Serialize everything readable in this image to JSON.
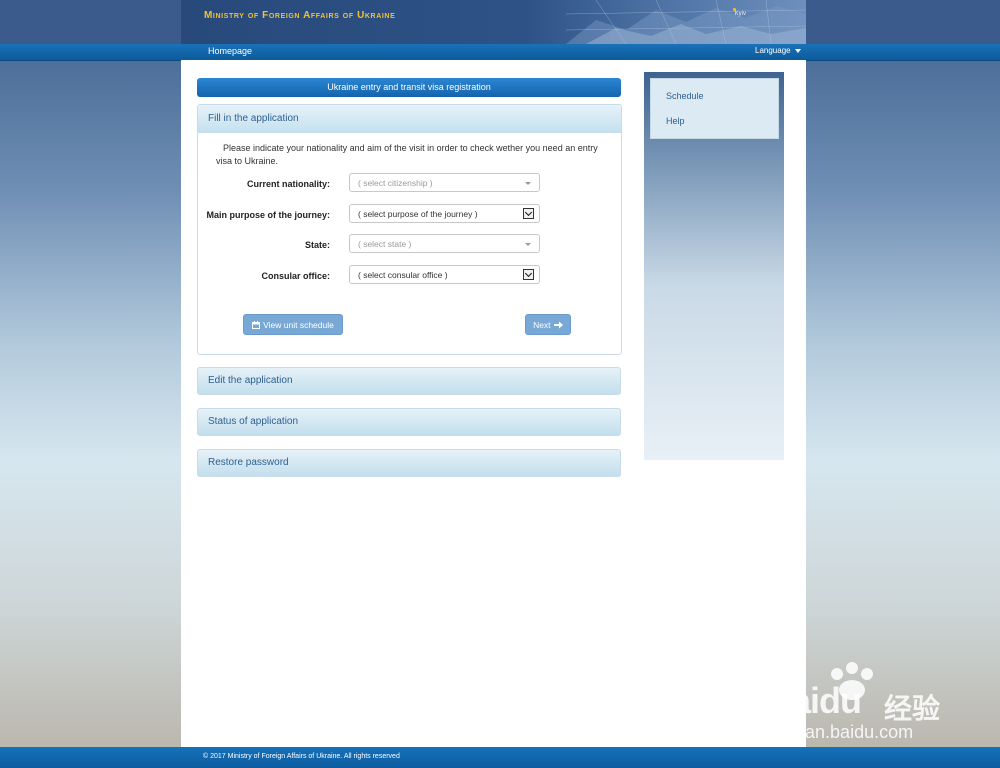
{
  "header": {
    "ministry_title": "Ministry of Foreign Affairs of Ukraine",
    "map_city_label": "Kyiv"
  },
  "nav": {
    "home": "Homepage",
    "language": "Language"
  },
  "main": {
    "registration_title": "Ukraine entry and transit visa registration",
    "fill_panel": {
      "title": "Fill in the application",
      "intro": "Please indicate your nationality and aim of the visit in order to check wether you need an entry visa to Ukraine.",
      "fields": [
        {
          "label": "Current nationality:",
          "value": "( select citizenship )"
        },
        {
          "label": "Main purpose of the journey:",
          "value": "( select purpose of the journey )"
        },
        {
          "label": "State:",
          "value": "( select state )"
        },
        {
          "label": "Consular office:",
          "value": "( select consular office )"
        }
      ],
      "view_schedule_button": "View unit schedule",
      "next_button": "Next"
    },
    "accordion": [
      {
        "label": "Edit the application"
      },
      {
        "label": "Status of application"
      },
      {
        "label": "Restore password"
      }
    ]
  },
  "sidebar": {
    "links": [
      {
        "label": "Schedule"
      },
      {
        "label": "Help"
      }
    ]
  },
  "footer": {
    "copyright": "© 2017 Ministry of Foreign Affairs of Ukraine. All rights reserved"
  },
  "watermark": {
    "brand": "Bai",
    "brand_suffix": "du",
    "cn": "经验",
    "url": "jingyan.baidu.com"
  },
  "colors": {
    "accent": "#1464ad",
    "title_gold": "#f2c230",
    "panel_text": "#2d5f91"
  }
}
